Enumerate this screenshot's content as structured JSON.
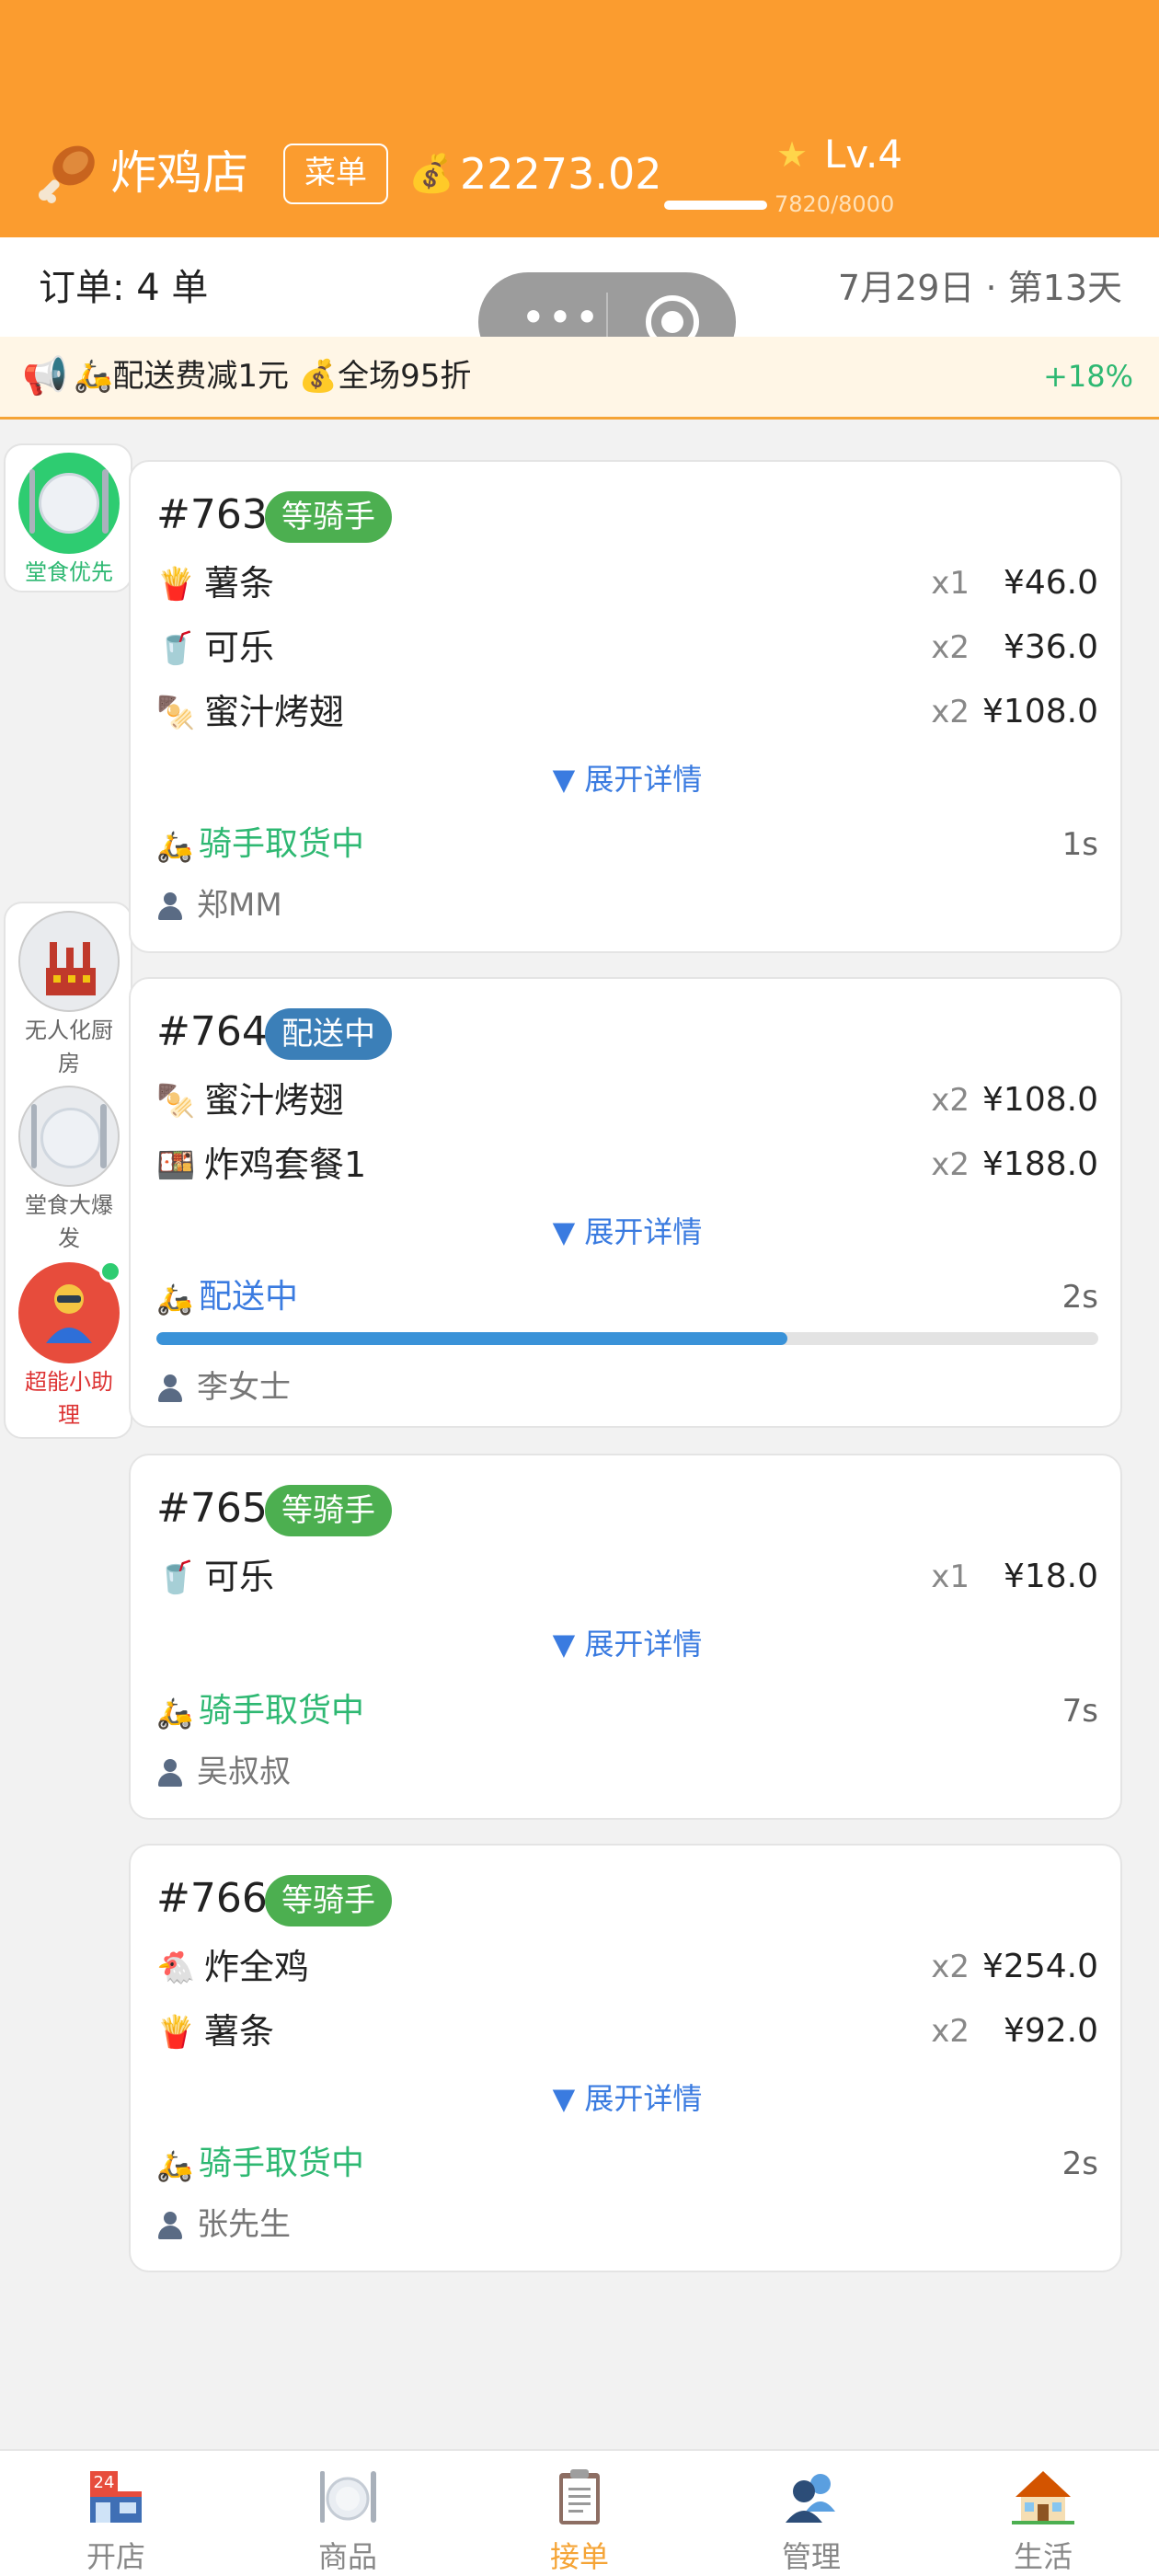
{
  "header": {
    "shop_name": "炸鸡店",
    "menu_label": "菜单",
    "money": "22273.02",
    "level": "Lv.4",
    "xp": "7820/8000",
    "xp_fraction": 0.98,
    "brand_color": "#fb9c2f"
  },
  "info": {
    "orders": "订单: 4 单",
    "date": "7月29日 · 第13天"
  },
  "promo": {
    "text": "🛵配送费减1元 💰全场95折",
    "percent": "+18%"
  },
  "side": {
    "priority_label": "堂食优先",
    "buttons": [
      {
        "label": "无人化厨房"
      },
      {
        "label": "堂食大爆发"
      },
      {
        "label": "超能小助理"
      }
    ]
  },
  "orders": [
    {
      "id": "#763",
      "badge": "等骑手",
      "items": [
        {
          "icon": "🍟",
          "name": "薯条",
          "qty": "x1",
          "price": "¥46.0"
        },
        {
          "icon": "🥤",
          "name": "可乐",
          "qty": "x2",
          "price": "¥36.0"
        },
        {
          "icon": "🍢",
          "name": "蜜汁烤翅",
          "qty": "x2",
          "price": "¥108.0"
        }
      ],
      "expand": "▼ 展开详情",
      "status": "骑手取货中",
      "time": "1s",
      "customer": "郑MM"
    },
    {
      "id": "#764",
      "badge": "配送中",
      "items": [
        {
          "icon": "🍢",
          "name": "蜜汁烤翅",
          "qty": "x2",
          "price": "¥108.0"
        },
        {
          "icon": "🍱",
          "name": "炸鸡套餐1",
          "qty": "x2",
          "price": "¥188.0"
        }
      ],
      "expand": "▼ 展开详情",
      "status": "配送中",
      "time": "2s",
      "progress": 0.67,
      "customer": "李女士"
    },
    {
      "id": "#765",
      "badge": "等骑手",
      "items": [
        {
          "icon": "🥤",
          "name": "可乐",
          "qty": "x1",
          "price": "¥18.0"
        }
      ],
      "expand": "▼ 展开详情",
      "status": "骑手取货中",
      "time": "7s",
      "customer": "吴叔叔"
    },
    {
      "id": "#766",
      "badge": "等骑手",
      "items": [
        {
          "icon": "🐔",
          "name": "炸全鸡",
          "qty": "x2",
          "price": "¥254.0"
        },
        {
          "icon": "🍟",
          "name": "薯条",
          "qty": "x2",
          "price": "¥92.0"
        }
      ],
      "expand": "▼ 展开详情",
      "status": "骑手取货中",
      "time": "2s",
      "customer": "张先生"
    }
  ],
  "tabs": [
    {
      "label": "开店",
      "icon": "store-icon"
    },
    {
      "label": "商品",
      "icon": "plate-icon"
    },
    {
      "label": "接单",
      "icon": "clipboard-icon",
      "active": true
    },
    {
      "label": "管理",
      "icon": "people-icon"
    },
    {
      "label": "生活",
      "icon": "house-icon"
    }
  ]
}
